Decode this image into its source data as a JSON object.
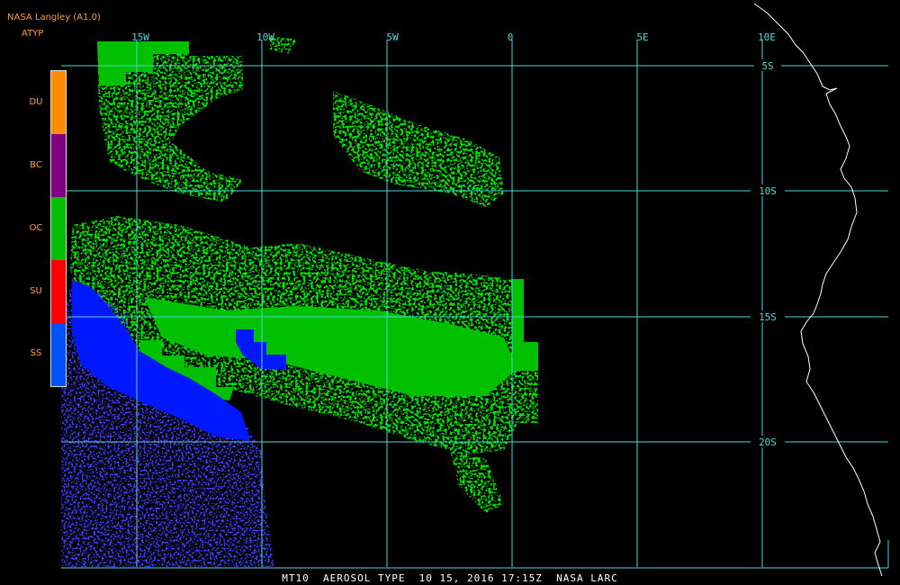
{
  "header": {
    "title": "NASA Langley (A1.0)",
    "product": "ATYP"
  },
  "legend": {
    "items": [
      {
        "label": "DU",
        "color": "#ff8c00"
      },
      {
        "label": "BC",
        "color": "#800080"
      },
      {
        "label": "OC",
        "color": "#00c000"
      },
      {
        "label": "SU",
        "color": "#ff0000"
      },
      {
        "label": "SS",
        "color": "#0050ff"
      }
    ]
  },
  "map": {
    "grid_color": "#4fd6d6",
    "coast_color": "#ffffff",
    "longitude_labels": [
      "15W",
      "10W",
      "5W",
      "0",
      "5E",
      "10E"
    ],
    "latitude_labels": [
      "5S",
      "10S",
      "15S",
      "20S"
    ]
  },
  "footer": {
    "caption": "MT10  AEROSOL TYPE  10 15, 2016 17:15Z  NASA LARC"
  }
}
